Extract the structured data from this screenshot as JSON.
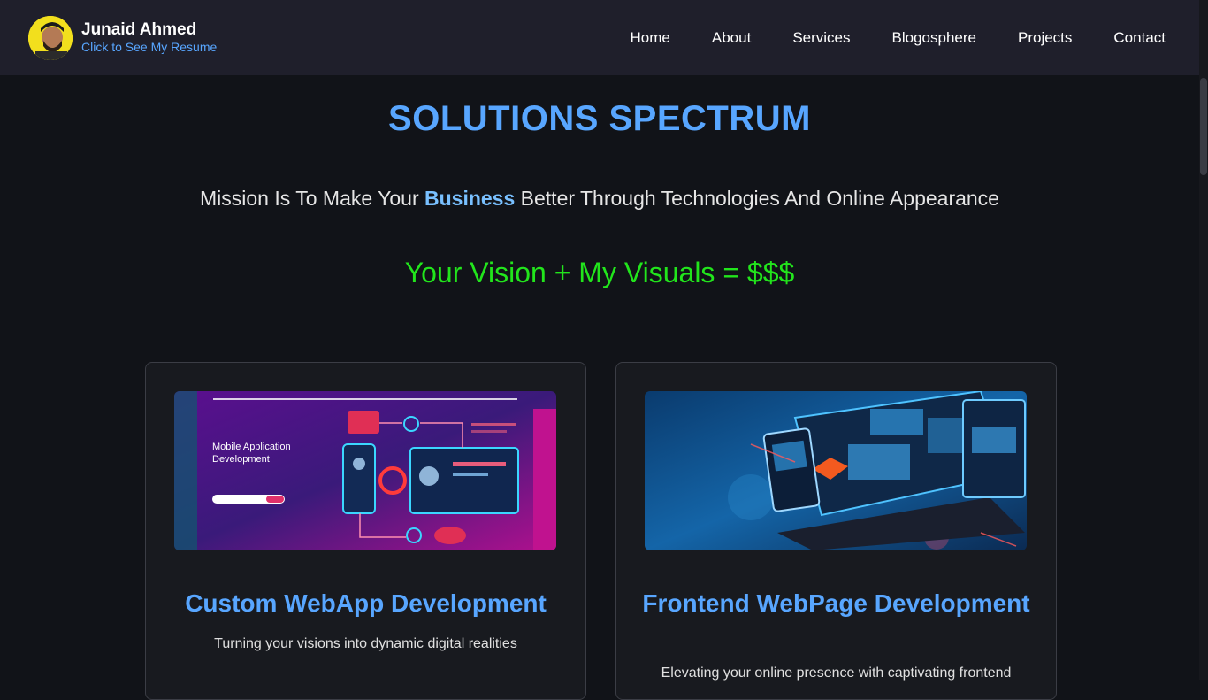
{
  "brand": {
    "name": "Junaid Ahmed",
    "subtitle": "Click to See My Resume"
  },
  "nav": {
    "items": [
      {
        "label": "Home"
      },
      {
        "label": "About"
      },
      {
        "label": "Services"
      },
      {
        "label": "Blogosphere"
      },
      {
        "label": "Projects"
      },
      {
        "label": "Contact"
      }
    ]
  },
  "section": {
    "title": "SOLUTIONS SPECTRUM",
    "mission_pre": "Mission Is To Make Your ",
    "mission_highlight": "Business",
    "mission_post": " Better Through Technologies And Online Appearance",
    "tagline": "Your Vision + My Visuals = $$$"
  },
  "cards": [
    {
      "title": "Custom WebApp Development",
      "description": "Turning your visions into dynamic digital realities",
      "image_caption": "Mobile Application Development"
    },
    {
      "title": "Frontend WebPage Development",
      "description": "Elevating your online presence with captivating frontend"
    }
  ],
  "colors": {
    "accent_blue": "#58a6ff",
    "tagline_green": "#22e51c",
    "nav_bg": "#1f1f2b",
    "page_bg": "#111318"
  }
}
